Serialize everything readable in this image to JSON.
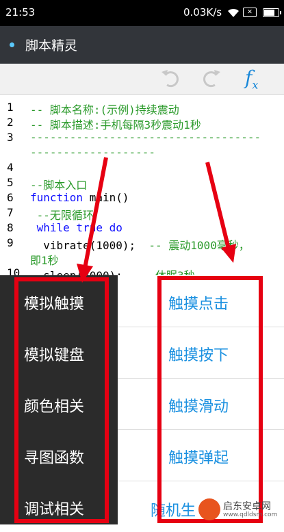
{
  "status_bar": {
    "time": "21:53",
    "speed": "0.03K/s",
    "battery_level": 0.75
  },
  "app": {
    "title": "脚本精灵"
  },
  "toolbar": {
    "undo_icon": "undo-icon",
    "redo_icon": "redo-icon",
    "fx_label": "f",
    "fx_sub": "x"
  },
  "code_lines": [
    {
      "num": "1",
      "text": "-- 脚本名称:(示例)持续震动",
      "style": "cmt"
    },
    {
      "num": "2",
      "text": "-- 脚本描述:手机每隔3秒震动1秒",
      "style": "cmt"
    },
    {
      "num": "3",
      "text": "-----------------------------------",
      "style": "cmt"
    },
    {
      "num": "",
      "text": "-------------------",
      "style": "cmt"
    },
    {
      "num": "4",
      "text": "",
      "style": "plain"
    },
    {
      "num": "5",
      "text": "--脚本入口",
      "style": "cmt"
    },
    {
      "num": "6",
      "kw": "function",
      "rest": " main()",
      "style": "mixed"
    },
    {
      "num": "7",
      "text": " --无限循环",
      "style": "cmt"
    },
    {
      "num": "8",
      "kw": " while true do",
      "rest": "",
      "style": "mixed"
    },
    {
      "num": "9",
      "code": "  vibrate(1000);",
      "comment": "  -- 震动1000毫秒，",
      "style": "codecmt"
    },
    {
      "num": "",
      "text": "即1秒",
      "style": "cmt",
      "indent": "0"
    },
    {
      "num": "10",
      "code": "  sleep(3000);",
      "comment": "  -- 休眠3秒",
      "style": "codecmt"
    }
  ],
  "menu_left": [
    "模拟触摸",
    "模拟键盘",
    "颜色相关",
    "寻图函数",
    "调试相关"
  ],
  "menu_right": [
    "触摸点击",
    "触摸按下",
    "触摸滑动",
    "触摸弹起",
    "随机生"
  ],
  "annotation_color": "#e60012",
  "watermark": {
    "name": "启东安卓网",
    "url": "www.qdldsm.com"
  }
}
